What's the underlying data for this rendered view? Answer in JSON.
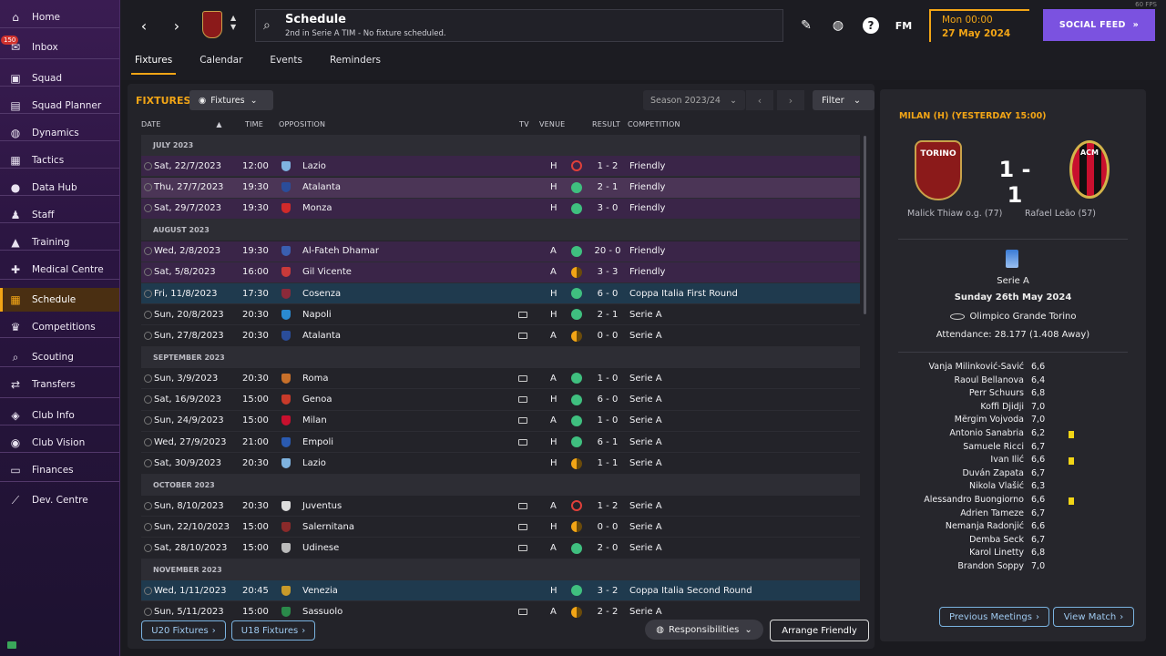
{
  "sidebar": {
    "inbox_badge": "150",
    "items": [
      {
        "label": "Home",
        "icon": "home-icon",
        "glyph": "⌂"
      },
      {
        "label": "Inbox",
        "icon": "inbox-icon",
        "glyph": "✉"
      },
      {
        "label": "Squad",
        "icon": "shirt-icon",
        "glyph": "▣"
      },
      {
        "label": "Squad Planner",
        "icon": "clipboard-icon",
        "glyph": "▤"
      },
      {
        "label": "Dynamics",
        "icon": "dynamics-icon",
        "glyph": "◍"
      },
      {
        "label": "Tactics",
        "icon": "tactics-icon",
        "glyph": "▦"
      },
      {
        "label": "Data Hub",
        "icon": "data-hub-icon",
        "glyph": "●"
      },
      {
        "label": "Staff",
        "icon": "staff-icon",
        "glyph": "♟"
      },
      {
        "label": "Training",
        "icon": "training-icon",
        "glyph": "▲"
      },
      {
        "label": "Medical Centre",
        "icon": "medical-icon",
        "glyph": "✚"
      },
      {
        "label": "Schedule",
        "icon": "calendar-icon",
        "glyph": "▦"
      },
      {
        "label": "Competitions",
        "icon": "trophy-icon",
        "glyph": "♛"
      },
      {
        "label": "Scouting",
        "icon": "scouting-icon",
        "glyph": "⌕"
      },
      {
        "label": "Transfers",
        "icon": "transfers-icon",
        "glyph": "⇄"
      },
      {
        "label": "Club Info",
        "icon": "shield-icon",
        "glyph": "◈"
      },
      {
        "label": "Club Vision",
        "icon": "vision-icon",
        "glyph": "◉"
      },
      {
        "label": "Finances",
        "icon": "finances-icon",
        "glyph": "▭"
      },
      {
        "label": "Dev. Centre",
        "icon": "dev-centre-icon",
        "glyph": "⟋"
      }
    ]
  },
  "topbar": {
    "title": "Schedule",
    "subtitle": "2nd in Serie A TIM - No fixture scheduled.",
    "fm_label": "FM",
    "date_line1": "Mon 00:00",
    "date_line2": "27 May 2024",
    "social_label": "SOCIAL FEED",
    "fps": "60 FPS",
    "tabs": [
      "Fixtures",
      "Calendar",
      "Events",
      "Reminders"
    ]
  },
  "fixtures": {
    "title": "FIXTURES",
    "view_label": "Fixtures",
    "season_label": "Season 2023/24",
    "filter_label": "Filter",
    "columns": {
      "date": "DATE",
      "time": "TIME",
      "opposition": "OPPOSITION",
      "tv": "TV",
      "venue": "VENUE",
      "result": "RESULT",
      "competition": "COMPETITION"
    },
    "months": [
      "JULY 2023",
      "AUGUST 2023",
      "SEPTEMBER 2023",
      "OCTOBER 2023",
      "NOVEMBER 2023"
    ],
    "rows": [
      {
        "date": "Sat, 22/7/2023",
        "time": "12:00",
        "opp": "Lazio",
        "venue": "H",
        "res": "L",
        "score": "1 - 2",
        "comp": "Friendly",
        "kind": "friendly",
        "tv": false,
        "crest": "#7fb3e0"
      },
      {
        "date": "Thu, 27/7/2023",
        "time": "19:30",
        "opp": "Atalanta",
        "venue": "H",
        "res": "W",
        "score": "2 - 1",
        "comp": "Friendly",
        "kind": "hl",
        "tv": false,
        "crest": "#2a4d9a"
      },
      {
        "date": "Sat, 29/7/2023",
        "time": "19:30",
        "opp": "Monza",
        "venue": "H",
        "res": "W",
        "score": "3 - 0",
        "comp": "Friendly",
        "kind": "friendly",
        "tv": false,
        "crest": "#d02a2a"
      },
      {
        "date": "Wed, 2/8/2023",
        "time": "19:30",
        "opp": "Al-Fateh Dhamar",
        "venue": "A",
        "res": "W",
        "score": "20 - 0",
        "comp": "Friendly",
        "kind": "friendly",
        "tv": false,
        "crest": "#3a5fb0"
      },
      {
        "date": "Sat, 5/8/2023",
        "time": "16:00",
        "opp": "Gil Vicente",
        "venue": "A",
        "res": "D",
        "score": "3 - 3",
        "comp": "Friendly",
        "kind": "friendly",
        "tv": false,
        "crest": "#c83a3a"
      },
      {
        "date": "Fri, 11/8/2023",
        "time": "17:30",
        "opp": "Cosenza",
        "venue": "H",
        "res": "W",
        "score": "6 - 0",
        "comp": "Coppa Italia First Round",
        "kind": "cup",
        "tv": false,
        "crest": "#8a2a3a"
      },
      {
        "date": "Sun, 20/8/2023",
        "time": "20:30",
        "opp": "Napoli",
        "venue": "H",
        "res": "W",
        "score": "2 - 1",
        "comp": "Serie A",
        "kind": "league",
        "tv": true,
        "crest": "#2a8ad0"
      },
      {
        "date": "Sun, 27/8/2023",
        "time": "20:30",
        "opp": "Atalanta",
        "venue": "A",
        "res": "D",
        "score": "0 - 0",
        "comp": "Serie A",
        "kind": "league",
        "tv": true,
        "crest": "#2a4d9a"
      },
      {
        "date": "Sun, 3/9/2023",
        "time": "20:30",
        "opp": "Roma",
        "venue": "A",
        "res": "W",
        "score": "1 - 0",
        "comp": "Serie A",
        "kind": "league",
        "tv": true,
        "crest": "#c8702a"
      },
      {
        "date": "Sat, 16/9/2023",
        "time": "15:00",
        "opp": "Genoa",
        "venue": "H",
        "res": "W",
        "score": "6 - 0",
        "comp": "Serie A",
        "kind": "league",
        "tv": true,
        "crest": "#c83a2a"
      },
      {
        "date": "Sun, 24/9/2023",
        "time": "15:00",
        "opp": "Milan",
        "venue": "A",
        "res": "W",
        "score": "1 - 0",
        "comp": "Serie A",
        "kind": "league",
        "tv": true,
        "crest": "#c8102e"
      },
      {
        "date": "Wed, 27/9/2023",
        "time": "21:00",
        "opp": "Empoli",
        "venue": "H",
        "res": "W",
        "score": "6 - 1",
        "comp": "Serie A",
        "kind": "league",
        "tv": true,
        "crest": "#2a5ab0"
      },
      {
        "date": "Sat, 30/9/2023",
        "time": "20:30",
        "opp": "Lazio",
        "venue": "H",
        "res": "D",
        "score": "1 - 1",
        "comp": "Serie A",
        "kind": "league",
        "tv": false,
        "crest": "#7fb3e0"
      },
      {
        "date": "Sun, 8/10/2023",
        "time": "20:30",
        "opp": "Juventus",
        "venue": "A",
        "res": "L",
        "score": "1 - 2",
        "comp": "Serie A",
        "kind": "league",
        "tv": true,
        "crest": "#dddddd"
      },
      {
        "date": "Sun, 22/10/2023",
        "time": "15:00",
        "opp": "Salernitana",
        "venue": "H",
        "res": "D",
        "score": "0 - 0",
        "comp": "Serie A",
        "kind": "league",
        "tv": true,
        "crest": "#8a2a2a"
      },
      {
        "date": "Sat, 28/10/2023",
        "time": "15:00",
        "opp": "Udinese",
        "venue": "A",
        "res": "W",
        "score": "2 - 0",
        "comp": "Serie A",
        "kind": "league",
        "tv": true,
        "crest": "#bbbbbb"
      },
      {
        "date": "Wed, 1/11/2023",
        "time": "20:45",
        "opp": "Venezia",
        "venue": "H",
        "res": "W",
        "score": "3 - 2",
        "comp": "Coppa Italia Second Round",
        "kind": "cup",
        "tv": false,
        "crest": "#c89a2a"
      },
      {
        "date": "Sun, 5/11/2023",
        "time": "15:00",
        "opp": "Sassuolo",
        "venue": "A",
        "res": "D",
        "score": "2 - 2",
        "comp": "Serie A",
        "kind": "league",
        "tv": true,
        "crest": "#2a8a4a"
      }
    ],
    "u20_label": "U20 Fixtures",
    "u18_label": "U18 Fixtures",
    "responsibilities_label": "Responsibilities",
    "arrange_label": "Arrange Friendly"
  },
  "match": {
    "title": "MILAN (H) (YESTERDAY 15:00)",
    "home_crest_text": "TORINO",
    "away_crest_text": "ACM",
    "score": "1 - 1",
    "home_scorer": "Malick Thiaw o.g. (77)",
    "away_scorer": "Rafael Leão (57)",
    "competition": "Serie A",
    "date": "Sunday 26th May 2024",
    "stadium": "Olimpico Grande Torino",
    "attendance": "Attendance: 28.177 (1.408 Away)",
    "players": [
      {
        "name": "Vanja Milinković-Savić",
        "rating": "6,6",
        "yellow": false
      },
      {
        "name": "Raoul Bellanova",
        "rating": "6,4",
        "yellow": false
      },
      {
        "name": "Perr Schuurs",
        "rating": "6,8",
        "yellow": false
      },
      {
        "name": "Koffi Djidji",
        "rating": "7,0",
        "yellow": false
      },
      {
        "name": "Mërgim Vojvoda",
        "rating": "7,0",
        "yellow": false
      },
      {
        "name": "Antonio Sanabria",
        "rating": "6,2",
        "yellow": true
      },
      {
        "name": "Samuele Ricci",
        "rating": "6,7",
        "yellow": false
      },
      {
        "name": "Ivan Ilić",
        "rating": "6,6",
        "yellow": true
      },
      {
        "name": "Duván Zapata",
        "rating": "6,7",
        "yellow": false
      },
      {
        "name": "Nikola Vlašić",
        "rating": "6,3",
        "yellow": false
      },
      {
        "name": "Alessandro Buongiorno",
        "rating": "6,6",
        "yellow": true
      },
      {
        "name": "Adrien Tameze",
        "rating": "6,7",
        "yellow": false
      },
      {
        "name": "Nemanja Radonjić",
        "rating": "6,6",
        "yellow": false
      },
      {
        "name": "Demba Seck",
        "rating": "6,7",
        "yellow": false
      },
      {
        "name": "Karol Linetty",
        "rating": "6,8",
        "yellow": false
      },
      {
        "name": "Brandon Soppy",
        "rating": "7,0",
        "yellow": false
      }
    ],
    "prev_label": "Previous Meetings",
    "view_label": "View Match"
  }
}
